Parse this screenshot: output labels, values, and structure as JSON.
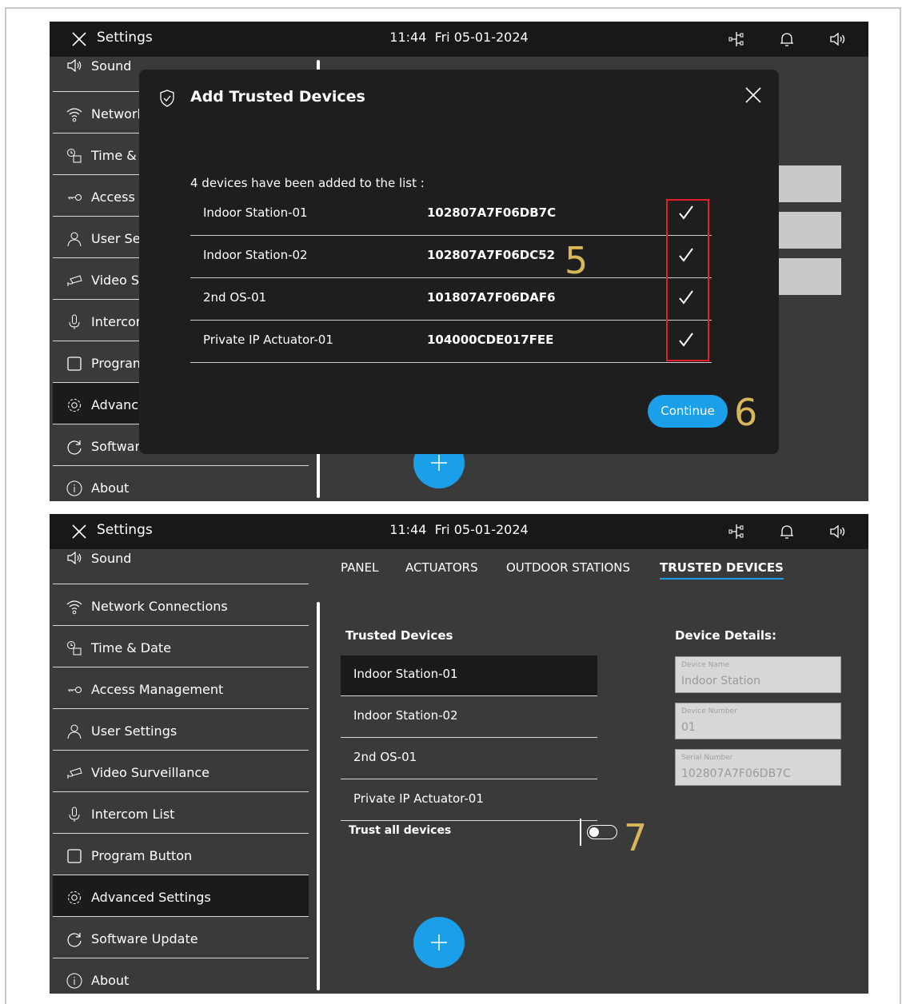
{
  "topbar": {
    "title": "Settings",
    "time": "11:44",
    "date": "Fri 05-01-2024"
  },
  "sidebar": {
    "items": [
      {
        "label": "Sound",
        "icon": "speaker-icon"
      },
      {
        "label": "Network Connections",
        "icon": "wifi-icon"
      },
      {
        "label": "Time & Date",
        "icon": "clock-calendar-icon"
      },
      {
        "label": "Access Management",
        "icon": "key-icon"
      },
      {
        "label": "User Settings",
        "icon": "user-icon"
      },
      {
        "label": "Video Surveillance",
        "icon": "camera-icon"
      },
      {
        "label": "Intercom List",
        "icon": "microphone-icon"
      },
      {
        "label": "Program Button",
        "icon": "square-icon"
      },
      {
        "label": "Advanced Settings",
        "icon": "gear-icon",
        "active": true
      },
      {
        "label": "Software Update",
        "icon": "refresh-icon"
      },
      {
        "label": "About",
        "icon": "info-icon"
      }
    ],
    "items_truncated": [
      "Sound",
      "Network",
      "Time & D",
      "Access M",
      "User Set",
      "Video Su",
      "Intercor",
      "Program",
      "Advance",
      "Softwar",
      "About"
    ]
  },
  "dialog": {
    "title": "Add Trusted Devices",
    "intro": "4 devices have been added to the list :",
    "devices": [
      {
        "name": "Indoor Station-01",
        "serial": "102807A7F06DB7C",
        "checked": true
      },
      {
        "name": "Indoor Station-02",
        "serial": "102807A7F06DC52",
        "checked": true
      },
      {
        "name": "2nd OS-01",
        "serial": "101807A7F06DAF6",
        "checked": true
      },
      {
        "name": "Private IP Actuator-01",
        "serial": "104000CDE017FEE",
        "checked": true
      }
    ],
    "continue_label": "Continue"
  },
  "callouts": {
    "five": "5",
    "six": "6",
    "seven": "7"
  },
  "tabs": [
    "PANEL",
    "ACTUATORS",
    "OUTDOOR STATIONS",
    "TRUSTED DEVICES"
  ],
  "active_tab": "TRUSTED DEVICES",
  "trusted": {
    "heading": "Trusted Devices",
    "list": [
      "Indoor Station-01",
      "Indoor Station-02",
      "2nd OS-01",
      "Private IP Actuator-01"
    ],
    "selected": "Indoor Station-01",
    "trust_all_label": "Trust all devices",
    "trust_all_on": false
  },
  "details": {
    "heading": "Device Details:",
    "fields": [
      {
        "label": "Device Name",
        "value": "Indoor Station"
      },
      {
        "label": "Device Number",
        "value": "01"
      },
      {
        "label": "Serial Number",
        "value": "102807A7F06DB7C"
      }
    ]
  },
  "colors": {
    "accent": "#1b9fe8",
    "callout": "#d8b65a",
    "highlight": "#e0202a",
    "bar": "#181818",
    "bg": "#3a3a3a"
  }
}
